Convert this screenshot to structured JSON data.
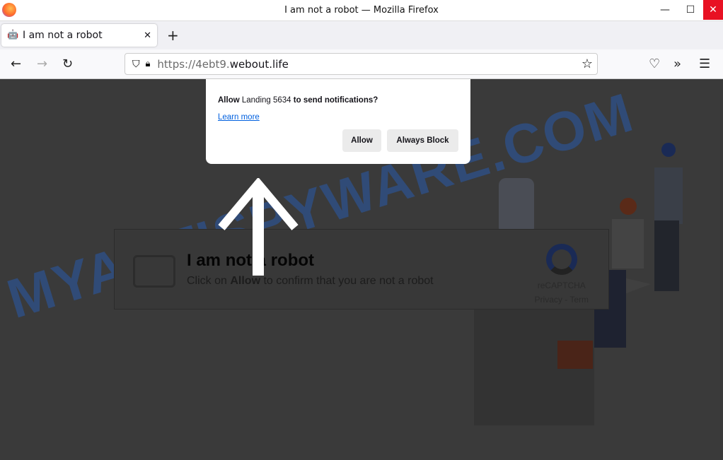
{
  "window": {
    "title": "I am not a robot — Mozilla Firefox",
    "minimize": "—",
    "maximize": "☐",
    "close": "✕"
  },
  "tab": {
    "label": "I am not a robot",
    "close": "✕",
    "new_tab": "+"
  },
  "nav": {
    "back": "←",
    "forward": "→",
    "reload": "↻",
    "url_prefix": "https://4ebt9.",
    "url_host": "webout.life",
    "bookmark": "☆",
    "pocket": "♡",
    "extensions": "»",
    "menu": "☰"
  },
  "popup": {
    "allow_word": "Allow",
    "site": "Landing 5634",
    "question": "to send notifications?",
    "learn_more": "Learn more",
    "allow_button": "Allow",
    "block_button": "Always Block"
  },
  "page": {
    "heading": "I am not a robot",
    "text_pre": "Click on ",
    "text_bold": "Allow",
    "text_post": " to confirm that you are not a robot",
    "recaptcha": "reCAPTCHA",
    "privacy": "Privacy - Term"
  },
  "watermark": "MYANTISPYWARE.COM"
}
